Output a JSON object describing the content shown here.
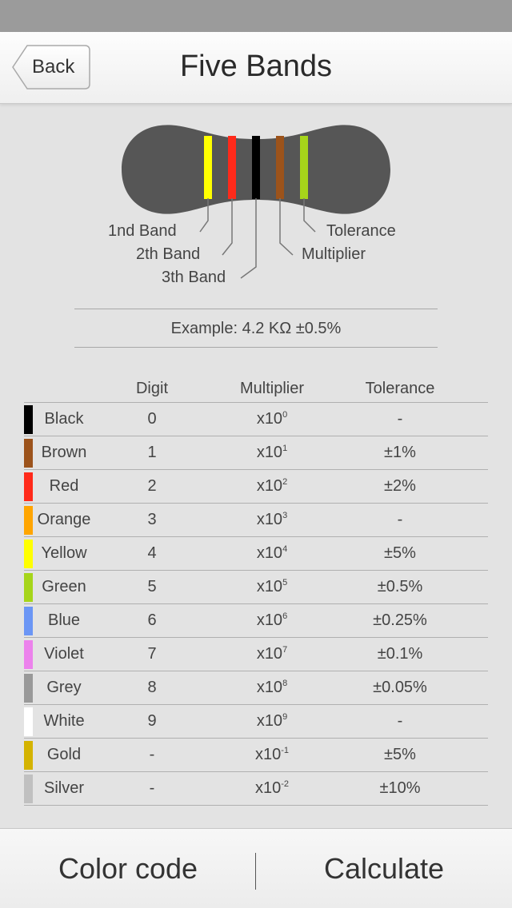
{
  "nav": {
    "back_label": "Back",
    "title": "Five Bands"
  },
  "diagram": {
    "band_colors": [
      "#ffff00",
      "#ff2a1a",
      "#000000",
      "#9c531b",
      "#a6d51a"
    ],
    "body_color": "#565656",
    "labels": {
      "band1": "1nd Band",
      "band2": "2th Band",
      "band3": "3th Band",
      "multiplier": "Multiplier",
      "tolerance": "Tolerance"
    }
  },
  "example": "Example: 4.2 KΩ ±0.5%",
  "table": {
    "headers": {
      "digit": "Digit",
      "multiplier": "Multiplier",
      "tolerance": "Tolerance"
    },
    "rows": [
      {
        "name": "Black",
        "color": "#000000",
        "digit": "0",
        "mult_base": "x10",
        "mult_exp": "0",
        "tolerance": "-"
      },
      {
        "name": "Brown",
        "color": "#9c531b",
        "digit": "1",
        "mult_base": "x10",
        "mult_exp": "1",
        "tolerance": "±1%"
      },
      {
        "name": "Red",
        "color": "#ff2a1a",
        "digit": "2",
        "mult_base": "x10",
        "mult_exp": "2",
        "tolerance": "±2%"
      },
      {
        "name": "Orange",
        "color": "#ffa500",
        "digit": "3",
        "mult_base": "x10",
        "mult_exp": "3",
        "tolerance": "-"
      },
      {
        "name": "Yellow",
        "color": "#ffff00",
        "digit": "4",
        "mult_base": "x10",
        "mult_exp": "4",
        "tolerance": "±5%"
      },
      {
        "name": "Green",
        "color": "#a6d51a",
        "digit": "5",
        "mult_base": "x10",
        "mult_exp": "5",
        "tolerance": "±0.5%"
      },
      {
        "name": "Blue",
        "color": "#6b96f5",
        "digit": "6",
        "mult_base": "x10",
        "mult_exp": "6",
        "tolerance": "±0.25%"
      },
      {
        "name": "Violet",
        "color": "#ec82ec",
        "digit": "7",
        "mult_base": "x10",
        "mult_exp": "7",
        "tolerance": "±0.1%"
      },
      {
        "name": "Grey",
        "color": "#999999",
        "digit": "8",
        "mult_base": "x10",
        "mult_exp": "8",
        "tolerance": "±0.05%"
      },
      {
        "name": "White",
        "color": "#ffffff",
        "digit": "9",
        "mult_base": "x10",
        "mult_exp": "9",
        "tolerance": "-"
      },
      {
        "name": "Gold",
        "color": "#d4b300",
        "digit": "-",
        "mult_base": "x10",
        "mult_exp": "-1",
        "tolerance": "±5%"
      },
      {
        "name": "Silver",
        "color": "#c0c0c0",
        "digit": "-",
        "mult_base": "x10",
        "mult_exp": "-2",
        "tolerance": "±10%"
      }
    ]
  },
  "tabs": {
    "color_code": "Color code",
    "calculate": "Calculate"
  }
}
